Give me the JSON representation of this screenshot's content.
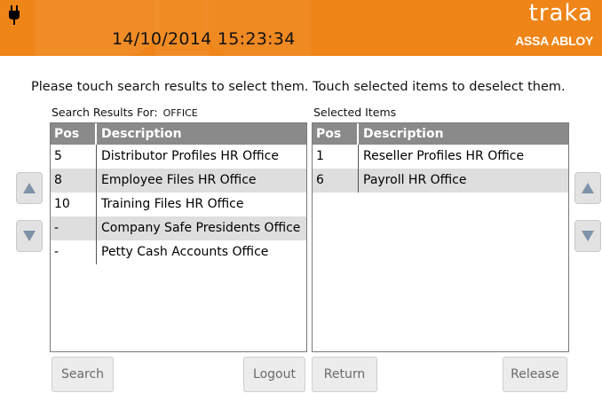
{
  "header": {
    "datetime": "14/10/2014 15:23:34",
    "logo_main": "traka",
    "logo_sub": "ASSA ABLOY",
    "accent_color": "#ef8518"
  },
  "instruction": "Please touch search results to select them. Touch selected items to deselect them.",
  "search_results": {
    "caption": "Search Results For:",
    "query": "OFFICE",
    "columns": {
      "pos": "Pos",
      "description": "Description"
    },
    "rows": [
      {
        "pos": "5",
        "description": "Distributor Profiles HR Office"
      },
      {
        "pos": "8",
        "description": "Employee Files HR Office"
      },
      {
        "pos": "10",
        "description": "Training Files HR Office"
      },
      {
        "pos": "-",
        "description": "Company Safe Presidents Office"
      },
      {
        "pos": "-",
        "description": "Petty Cash Accounts Office"
      }
    ]
  },
  "selected_items": {
    "caption": "Selected Items",
    "columns": {
      "pos": "Pos",
      "description": "Description"
    },
    "rows": [
      {
        "pos": "1",
        "description": "Reseller Profiles HR Office"
      },
      {
        "pos": "6",
        "description": "Payroll HR Office"
      }
    ]
  },
  "buttons": {
    "search": "Search",
    "logout": "Logout",
    "return": "Return",
    "release": "Release"
  },
  "icons": {
    "plug": "plug-icon",
    "up": "up-arrow-icon",
    "down": "down-arrow-icon"
  }
}
